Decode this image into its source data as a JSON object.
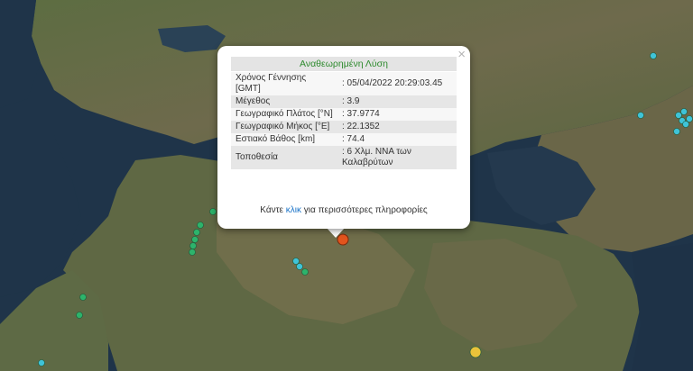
{
  "popup": {
    "title": "Αναθεωρημένη Λύση",
    "close_symbol": "×",
    "rows": [
      {
        "label": "Χρόνος Γέννησης [GMT]",
        "value": ": 05/04/2022 20:29:03.45"
      },
      {
        "label": "Μέγεθος",
        "value": ": 3.9"
      },
      {
        "label": "Γεωγραφικό Πλάτος [°N]",
        "value": ": 37.9774"
      },
      {
        "label": "Γεωγραφικό Μήκος [°E]",
        "value": ": 22.1352"
      },
      {
        "label": "Εστιακό Βάθος [km]",
        "value": ": 74.4"
      },
      {
        "label": "Τοποθεσία",
        "value": ": 6 Χλμ. ΝΝΑ των Καλαβρύτων"
      }
    ],
    "more_prefix": "Κάντε ",
    "more_link": "κλικ",
    "more_suffix": " για περισσότερες πληροφορίες"
  },
  "map": {
    "style": "satellite",
    "colors": {
      "sea": "#1e3247",
      "land": "#5a6a3f",
      "mountain": "#7a6e58"
    },
    "markers": [
      {
        "type": "selected-event",
        "color": "#e2541d"
      },
      {
        "type": "event",
        "color": "#2db36b"
      },
      {
        "type": "event",
        "color": "#2db36b"
      },
      {
        "type": "event",
        "color": "#2db36b"
      },
      {
        "type": "event",
        "color": "#2db36b"
      },
      {
        "type": "event",
        "color": "#2db36b"
      },
      {
        "type": "event",
        "color": "#2db36b"
      },
      {
        "type": "event",
        "color": "#3fc3d8"
      },
      {
        "type": "event",
        "color": "#3fc3d8"
      },
      {
        "type": "event",
        "color": "#2db36b"
      },
      {
        "type": "event",
        "color": "#2db36b"
      },
      {
        "type": "event",
        "color": "#2db36b"
      },
      {
        "type": "event",
        "color": "#3fc3d8"
      },
      {
        "type": "event",
        "color": "#3fc3d8"
      },
      {
        "type": "event",
        "color": "#3fc3d8"
      },
      {
        "type": "event",
        "color": "#3fc3d8"
      },
      {
        "type": "event",
        "color": "#3fc3d8"
      },
      {
        "type": "event",
        "color": "#3fc3d8"
      },
      {
        "type": "event",
        "color": "#3fc3d8"
      },
      {
        "type": "event",
        "color": "#3fc3d8"
      },
      {
        "type": "event",
        "color": "#e9c23a"
      },
      {
        "type": "event",
        "color": "#3fc3d8"
      }
    ]
  }
}
